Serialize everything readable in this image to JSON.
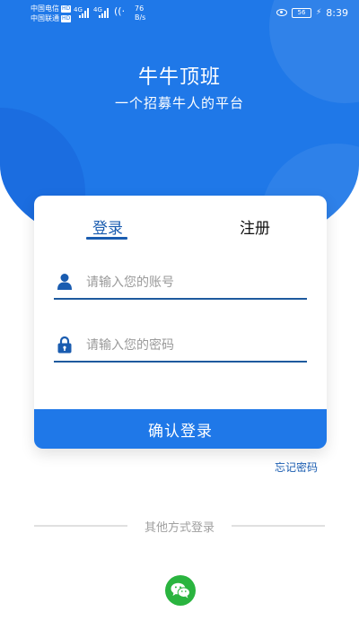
{
  "status_bar": {
    "carrier1": "中国电信",
    "carrier2": "中国联通",
    "hd": "HD",
    "net1": "4G",
    "net2": "4G",
    "speed_value": "76",
    "speed_unit": "B/s",
    "battery": "56",
    "time": "8:39"
  },
  "header": {
    "title": "牛牛顶班",
    "subtitle": "一个招募牛人的平台"
  },
  "tabs": {
    "login": "登录",
    "register": "注册"
  },
  "form": {
    "account_placeholder": "请输入您的账号",
    "password_placeholder": "请输入您的密码",
    "submit_label": "确认登录",
    "forgot_label": "忘记密码"
  },
  "other_login": {
    "label": "其他方式登录",
    "wechat_icon": "wechat-icon"
  },
  "colors": {
    "primary": "#1f78e8",
    "tab_active": "#1a5cb0",
    "wechat": "#2ab43f"
  }
}
